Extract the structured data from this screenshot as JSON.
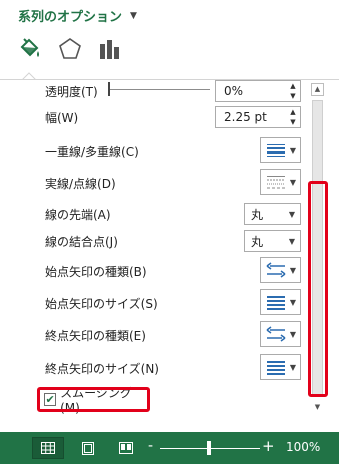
{
  "pane": {
    "title": "系列のオプション",
    "tabs": [
      {
        "name": "fill-line-tab",
        "icon": "paint-bucket-icon"
      },
      {
        "name": "effects-tab",
        "icon": "pentagon-icon"
      },
      {
        "name": "series-options-tab",
        "icon": "bar-chart-icon"
      }
    ]
  },
  "options": {
    "transparency": {
      "label": "透明度(T)",
      "value": "0%"
    },
    "width": {
      "label": "幅(W)",
      "value": "2.25 pt"
    },
    "compound_type": {
      "label": "一重線/多重線(C)",
      "icon": "compound-lines-icon"
    },
    "dash_type": {
      "label": "実線/点線(D)",
      "icon": "dash-lines-icon"
    },
    "cap_type": {
      "label": "線の先端(A)",
      "value": "丸"
    },
    "join_type": {
      "label": "線の結合点(J)",
      "value": "丸"
    },
    "begin_arrow_type": {
      "label": "始点矢印の種類(B)",
      "icon": "arrow-type-icon"
    },
    "begin_arrow_size": {
      "label": "始点矢印のサイズ(S)",
      "icon": "arrow-size-icon"
    },
    "end_arrow_type": {
      "label": "終点矢印の種類(E)",
      "icon": "arrow-type-icon"
    },
    "end_arrow_size": {
      "label": "終点矢印のサイズ(N)",
      "icon": "arrow-size-icon"
    },
    "smoothing": {
      "label": "スムージング(M)",
      "checked": true
    }
  },
  "statusbar": {
    "zoom": "100%",
    "zoom_minus": "-",
    "zoom_plus": "+"
  },
  "colors": {
    "accent": "#217346",
    "highlight": "#e2001a",
    "icon_blue": "#2b6cb0"
  }
}
